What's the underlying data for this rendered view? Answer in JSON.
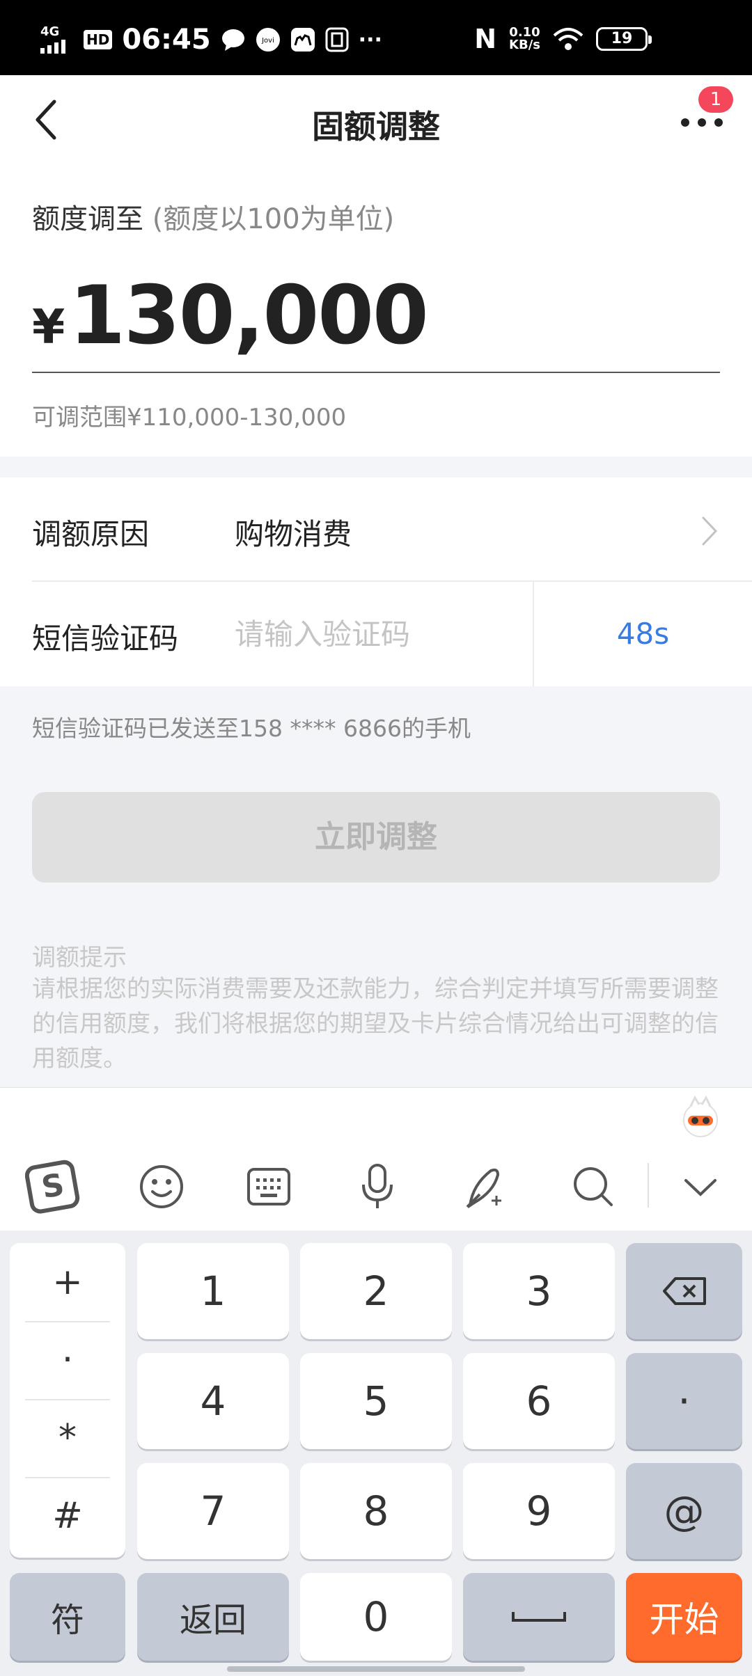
{
  "status_bar": {
    "network": "4G",
    "hd": "HD",
    "time": "06:45",
    "more": "···",
    "nfc": "N",
    "speed_value": "0.10",
    "speed_unit": "KB/s",
    "battery": "19"
  },
  "header": {
    "title": "固额调整",
    "badge_count": "1"
  },
  "amount": {
    "label": "额度调至",
    "hint": "(额度以100为单位)",
    "currency": "¥",
    "value": "130,000",
    "range": "可调范围¥110,000-130,000"
  },
  "form": {
    "reason_label": "调额原因",
    "reason_value": "购物消费",
    "sms_label": "短信验证码",
    "sms_placeholder": "请输入验证码",
    "countdown": "48s",
    "sms_note": "短信验证码已发送至158 **** 6866的手机"
  },
  "submit_label": "立即调整",
  "tips": {
    "title": "调额提示",
    "text": "请根据您的实际消费需要及还款能力，综合判定并填写所需要调整的信用额度，我们将根据您的期望及卡片综合情况给出可调整的信用额度。"
  },
  "keyboard": {
    "toolbar_icons": [
      "sogou-logo-icon",
      "emoji-icon",
      "keyboard-icon",
      "microphone-icon",
      "handwriting-icon",
      "search-icon",
      "collapse-icon"
    ],
    "symbols": [
      "+",
      "·",
      "*",
      "#"
    ],
    "digits": [
      "1",
      "2",
      "3",
      "4",
      "5",
      "6",
      "7",
      "8",
      "9",
      "0"
    ],
    "dot_key": "·",
    "at_key": "@",
    "symbol_switch": "符",
    "back_key": "返回",
    "go_key": "开始"
  },
  "colors": {
    "accent_blue": "#3a7be0",
    "badge_red": "#f5475c",
    "go_orange": "#ff6b2d"
  }
}
